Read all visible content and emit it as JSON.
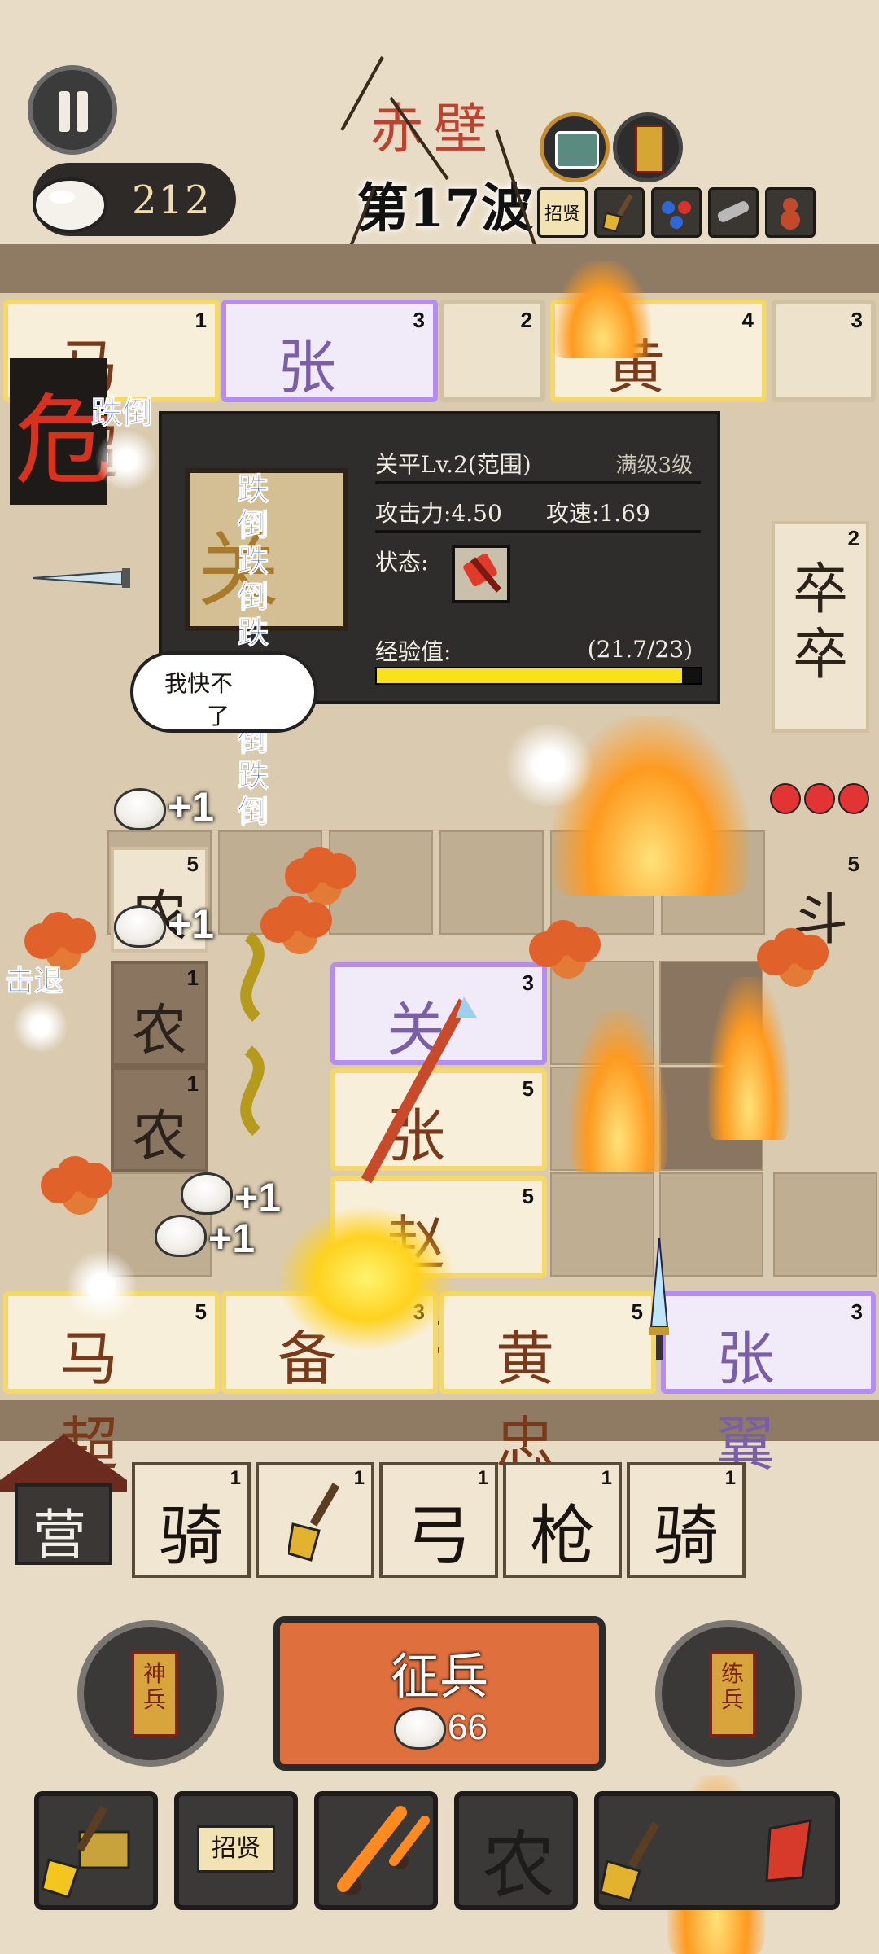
{
  "hud": {
    "buns": "212",
    "stage_name": "赤壁",
    "wave": "第17波",
    "buff_scroll_label": "招贤"
  },
  "top_row_cards": [
    {
      "name": "马超",
      "level": "1"
    },
    {
      "name": "张苞",
      "level": "3"
    },
    {
      "name": "",
      "level": "2"
    },
    {
      "name": "黄忠",
      "level": "4"
    },
    {
      "name": "",
      "level": "3"
    }
  ],
  "bottom_row_cards": [
    {
      "name": "马超",
      "level": "5"
    },
    {
      "name": "备",
      "level": "3"
    },
    {
      "name": "黄忠",
      "level": "5"
    },
    {
      "name": "张翼",
      "level": "3"
    }
  ],
  "middle_cards": [
    {
      "name": "关兴",
      "level": "3"
    },
    {
      "name": "张飞",
      "level": "5"
    },
    {
      "name": "赵云",
      "level": "5"
    }
  ],
  "farm_cards": [
    {
      "name": "农",
      "level": "5"
    },
    {
      "name": "农",
      "level": "1"
    },
    {
      "name": "农",
      "level": "1"
    }
  ],
  "right_column": {
    "soldier": "卒卒",
    "soldier_level": "2",
    "dou": "斗",
    "dou_level": "5"
  },
  "danger_label": "危",
  "knockdown_label": "跌倒",
  "repel_label": "击退",
  "plus_one": "+1",
  "speech": {
    "line1": "我快不",
    "line2": "了"
  },
  "popup": {
    "portrait_char": "关",
    "name": "关平Lv.2(范围)",
    "max_level": "满级3级",
    "attack": "攻击力:4.50",
    "speed": "攻速:1.69",
    "status_label": "状态:",
    "exp_label": "经验值:",
    "exp_value": "(21.7/23)",
    "exp_progress": 0.943
  },
  "camp_label": "营",
  "bench": [
    {
      "label": "骑",
      "level": "1",
      "icon": "none"
    },
    {
      "label": "",
      "level": "1",
      "icon": "shovel-icon"
    },
    {
      "label": "弓",
      "level": "1",
      "icon": "none"
    },
    {
      "label": "枪",
      "level": "1",
      "icon": "none"
    },
    {
      "label": "骑",
      "level": "1",
      "icon": "none"
    }
  ],
  "controls": {
    "left_tag": "神兵",
    "right_tag": "练兵",
    "recruit_label": "征兵",
    "recruit_cost": "66"
  },
  "actions": {
    "scroll_label": "招贤",
    "farm_label": "农"
  },
  "colors": {
    "gold_frame": "#f4d86a",
    "purple_frame": "#b58cf2",
    "recruit_button": "#e06f3e",
    "danger_red": "#d7321d",
    "exp_bar": "#f8e21a"
  }
}
